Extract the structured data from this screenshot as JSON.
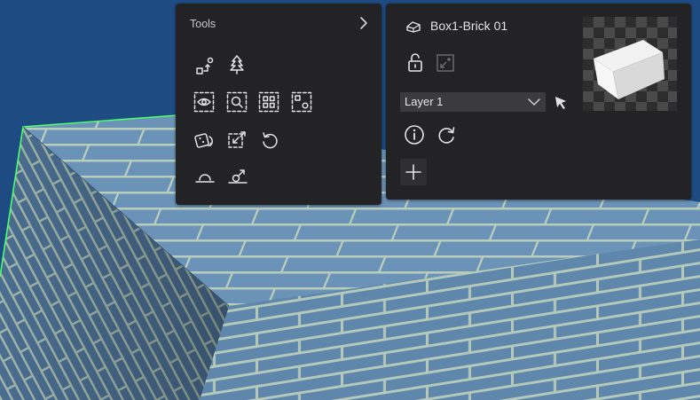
{
  "tools_panel": {
    "title": "Tools",
    "tools": [
      {
        "icon": "hierarchy-link-icon",
        "name": "link-tool-button"
      },
      {
        "icon": "tree-icon",
        "name": "tree-tool-button"
      },
      {
        "icon": "eye-select-icon",
        "name": "view-select-button"
      },
      {
        "icon": "zoom-select-icon",
        "name": "zoom-select-button"
      },
      {
        "icon": "grid-select-icon",
        "name": "grid-select-button"
      },
      {
        "icon": "frame-select-icon",
        "name": "frame-select-button"
      },
      {
        "icon": "dice-rotate-icon",
        "name": "randomize-button"
      },
      {
        "icon": "reset-transform-icon",
        "name": "reset-transform-button"
      },
      {
        "icon": "undo-icon",
        "name": "undo-button"
      },
      {
        "icon": "drop-to-ground-icon",
        "name": "drop-to-ground-button"
      },
      {
        "icon": "align-to-surface-icon",
        "name": "align-surface-button"
      }
    ]
  },
  "properties_panel": {
    "object_icon": "object-box-icon",
    "object_name": "Box1-Brick 01",
    "layer": {
      "value": "Layer 1"
    },
    "buttons": [
      "unlock-icon",
      "pivot-icon",
      "cursor-pick-icon",
      "info-icon",
      "refresh-icon",
      "plus-icon"
    ]
  },
  "colors": {
    "panel_bg": "#232326",
    "icon": "#e4e4e4",
    "sky": "#1e4b82",
    "brick_face": "#6f94b5",
    "mortar": "#b8ccbd",
    "edge_highlight": "#4cff6a"
  }
}
